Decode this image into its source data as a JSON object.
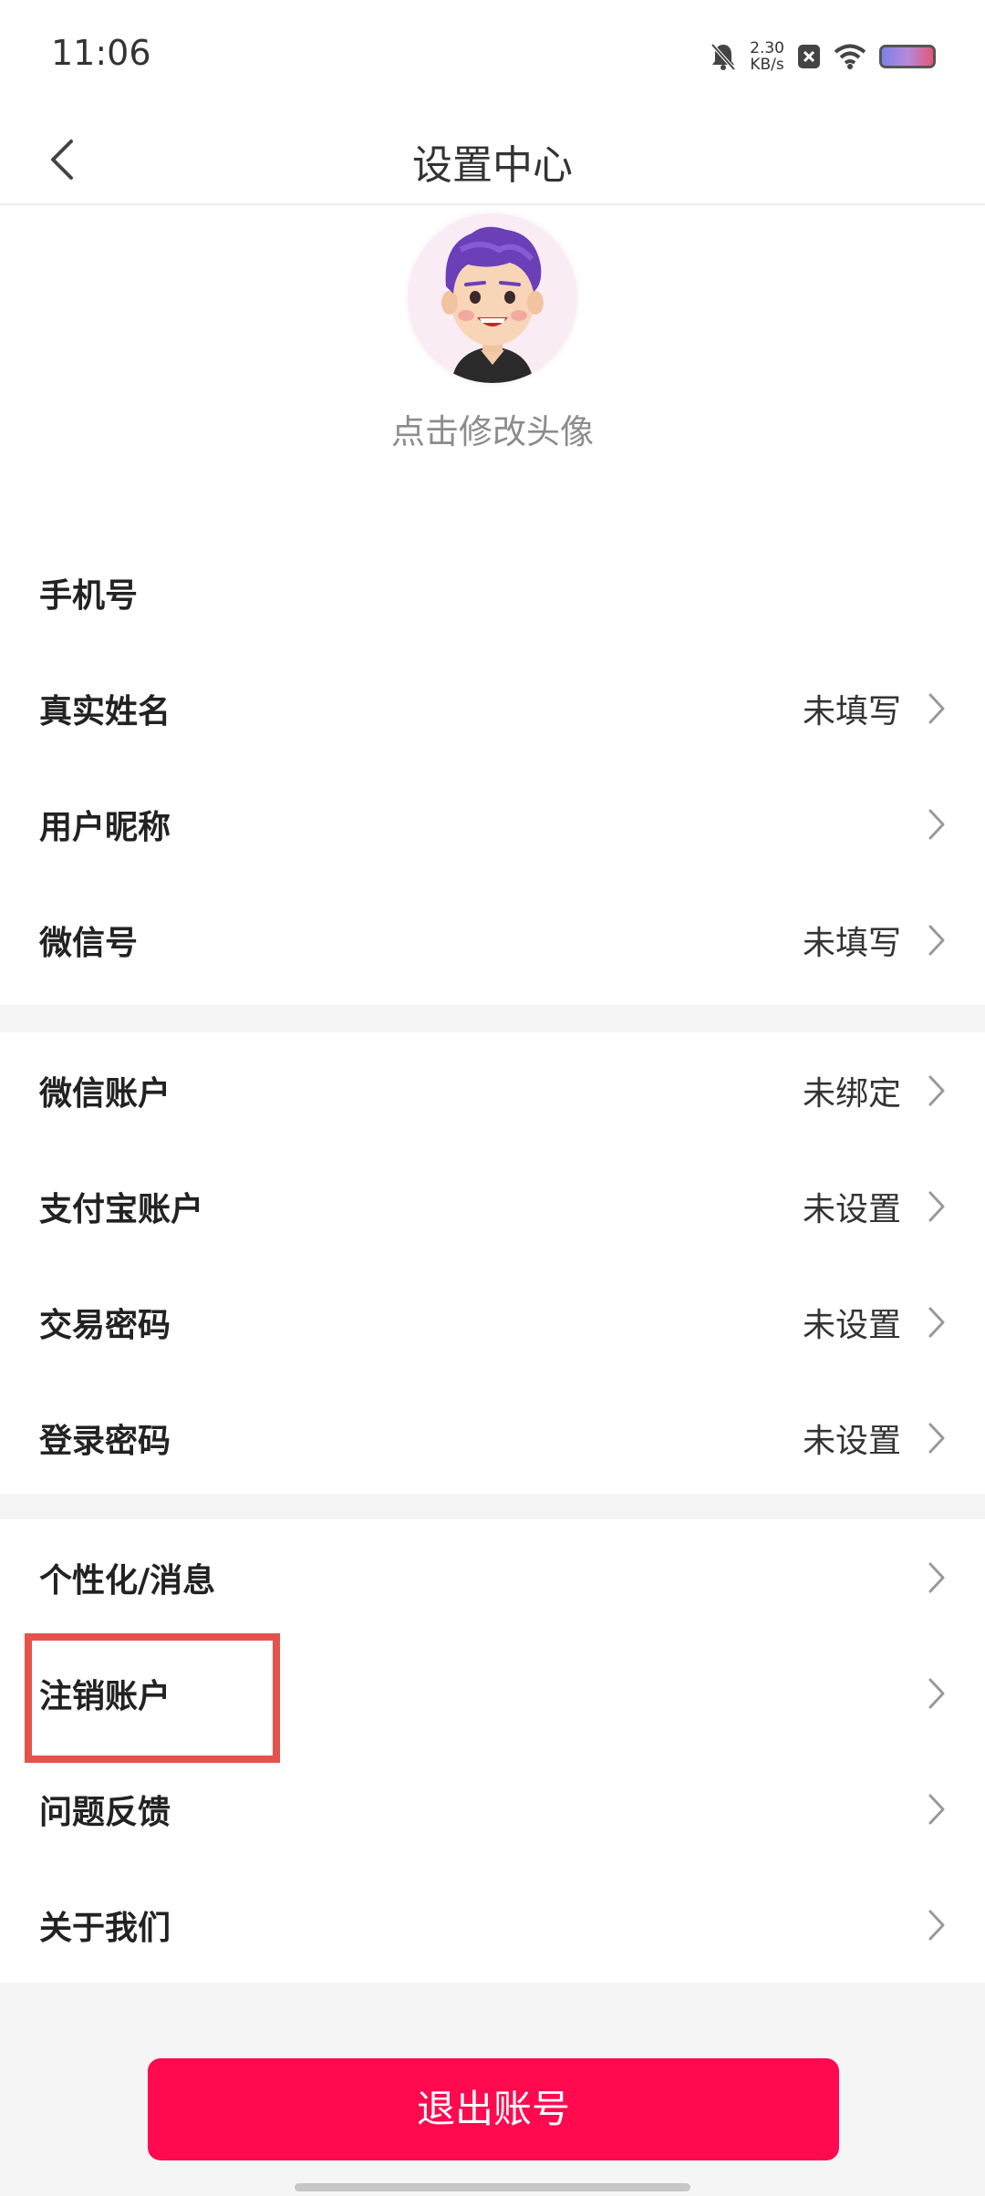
{
  "status_bar": {
    "time": "11:06",
    "net_speed_value": "2.30",
    "net_speed_unit": "KB/s",
    "icons": [
      "bell-muted-icon",
      "close-box-icon",
      "wifi-icon",
      "battery-icon"
    ]
  },
  "header": {
    "title": "设置中心",
    "back_icon": "chevron-left-icon"
  },
  "profile": {
    "avatar_hint": "点击修改头像"
  },
  "groups": [
    {
      "items": [
        {
          "label": "手机号",
          "value": "",
          "chevron": false
        },
        {
          "label": "真实姓名",
          "value": "未填写",
          "chevron": true
        },
        {
          "label": "用户昵称",
          "value": "",
          "chevron": true
        },
        {
          "label": "微信号",
          "value": "未填写",
          "chevron": true
        }
      ]
    },
    {
      "items": [
        {
          "label": "微信账户",
          "value": "未绑定",
          "chevron": true
        },
        {
          "label": "支付宝账户",
          "value": "未设置",
          "chevron": true
        },
        {
          "label": "交易密码",
          "value": "未设置",
          "chevron": true
        },
        {
          "label": "登录密码",
          "value": "未设置",
          "chevron": true
        }
      ]
    },
    {
      "items": [
        {
          "label": "个性化/消息",
          "value": "",
          "chevron": true
        },
        {
          "label": "注销账户",
          "value": "",
          "chevron": true
        },
        {
          "label": "问题反馈",
          "value": "",
          "chevron": true
        },
        {
          "label": "关于我们",
          "value": "",
          "chevron": true
        }
      ]
    }
  ],
  "logout_label": "退出账号",
  "colors": {
    "accent": "#ff0a4e",
    "highlight": "#e5524c",
    "page_bg": "#f5f5f5"
  }
}
